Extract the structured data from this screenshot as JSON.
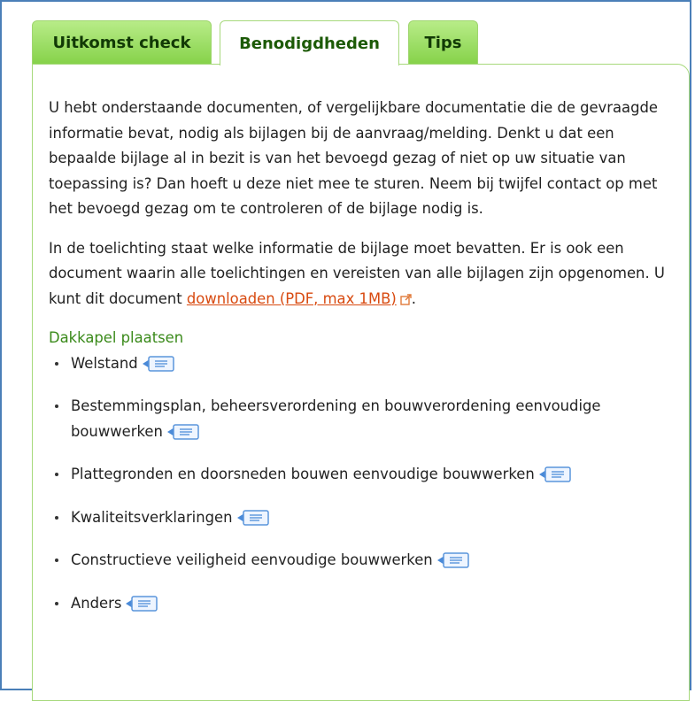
{
  "tabs": [
    {
      "label": "Uitkomst check"
    },
    {
      "label": "Benodigdheden"
    },
    {
      "label": "Tips"
    }
  ],
  "intro": {
    "paragraph1": "U hebt onderstaande documenten, of vergelijkbare documentatie die de gevraagde informatie bevat, nodig als bijlagen bij de aanvraag/melding. Denkt u dat een bepaalde bijlage al in bezit is van het bevoegd gezag of niet op uw situatie van toepassing is? Dan hoeft u deze niet mee te sturen. Neem bij twijfel contact op met het bevoegd gezag om te controleren of de bijlage nodig is.",
    "paragraph2_before": "In de toelichting staat welke informatie de bijlage moet bevatten. Er is ook een document waarin alle toelichtingen en vereisten van alle bijlagen zijn opgenomen. U kunt dit document ",
    "download_link": "downloaden (PDF, max 1MB)",
    "paragraph2_after": "."
  },
  "section": {
    "title": "Dakkapel plaatsen",
    "items": [
      {
        "label": "Welstand"
      },
      {
        "label": "Bestemmingsplan, beheersverordening en bouwverordening eenvoudige bouwwerken"
      },
      {
        "label": "Plattegronden en doorsneden bouwen eenvoudige bouwwerken"
      },
      {
        "label": "Kwaliteitsverklaringen"
      },
      {
        "label": "Constructieve veiligheid eenvoudige bouwwerken"
      },
      {
        "label": "Anders"
      }
    ]
  },
  "colors": {
    "tab_green": "#86d24a",
    "link_orange": "#d84a10",
    "section_green": "#3a8a1a",
    "frame_blue": "#4a7fb8"
  }
}
